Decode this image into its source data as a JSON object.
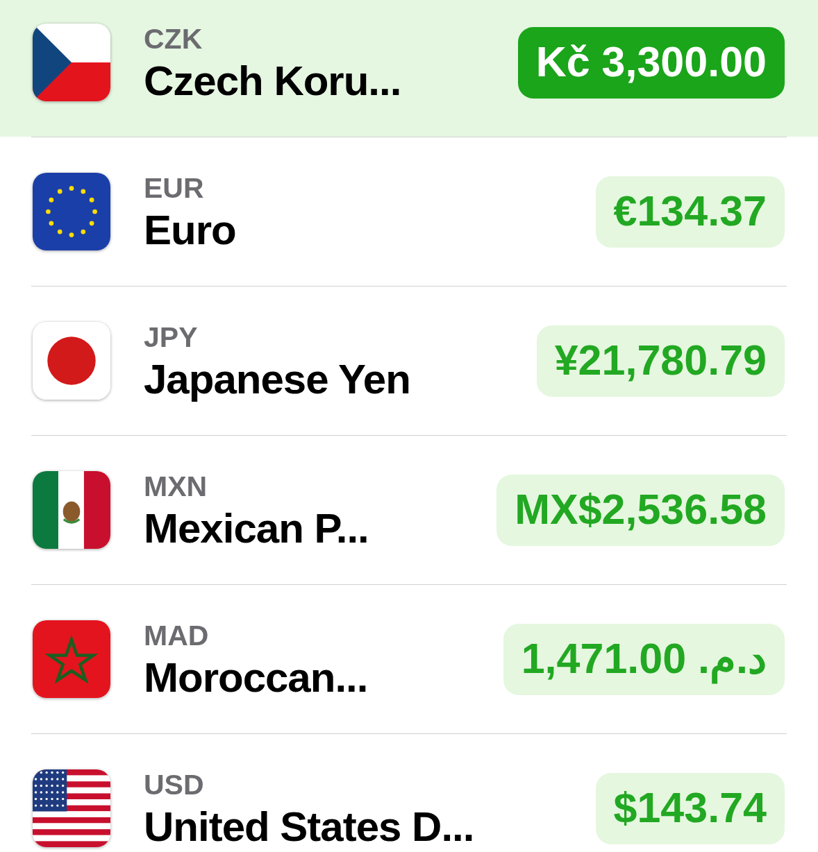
{
  "currencies": [
    {
      "code": "CZK",
      "name": "Czech Koru...",
      "amount": "Kč 3,300.00",
      "selected": true
    },
    {
      "code": "EUR",
      "name": "Euro",
      "amount": "€134.37",
      "selected": false
    },
    {
      "code": "JPY",
      "name": "Japanese Yen",
      "amount": "¥21,780.79",
      "selected": false
    },
    {
      "code": "MXN",
      "name": "Mexican P...",
      "amount": "MX$2,536.58",
      "selected": false
    },
    {
      "code": "MAD",
      "name": "Moroccan...",
      "amount": "1,471.00 د.م.‏",
      "selected": false
    },
    {
      "code": "USD",
      "name": "United States D...",
      "amount": "$143.74",
      "selected": false
    }
  ]
}
